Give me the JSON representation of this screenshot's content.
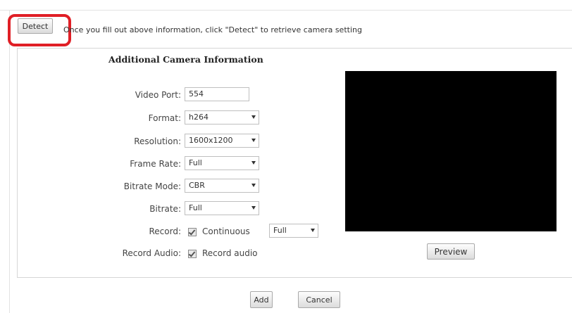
{
  "detect": {
    "button_label": "Detect",
    "instruction": "Once you fill out above information, click \"Detect\" to retrieve camera setting",
    "highlight_color": "#e01f26"
  },
  "section": {
    "title": "Additional Camera Information"
  },
  "form": {
    "video_port": {
      "label": "Video Port:",
      "value": "554"
    },
    "format": {
      "label": "Format:",
      "value": "h264"
    },
    "resolution": {
      "label": "Resolution:",
      "value": "1600x1200"
    },
    "frame_rate": {
      "label": "Frame Rate:",
      "value": "Full"
    },
    "bitrate_mode": {
      "label": "Bitrate Mode:",
      "value": "CBR"
    },
    "bitrate": {
      "label": "Bitrate:",
      "value": "Full"
    },
    "record": {
      "label": "Record:",
      "checkbox_label": "Continuous",
      "checked": true,
      "quality_value": "Full"
    },
    "record_audio": {
      "label": "Record Audio:",
      "checkbox_label": "Record audio",
      "checked": true
    }
  },
  "preview": {
    "button_label": "Preview",
    "background": "#000000"
  },
  "actions": {
    "add_label": "Add",
    "cancel_label": "Cancel"
  }
}
